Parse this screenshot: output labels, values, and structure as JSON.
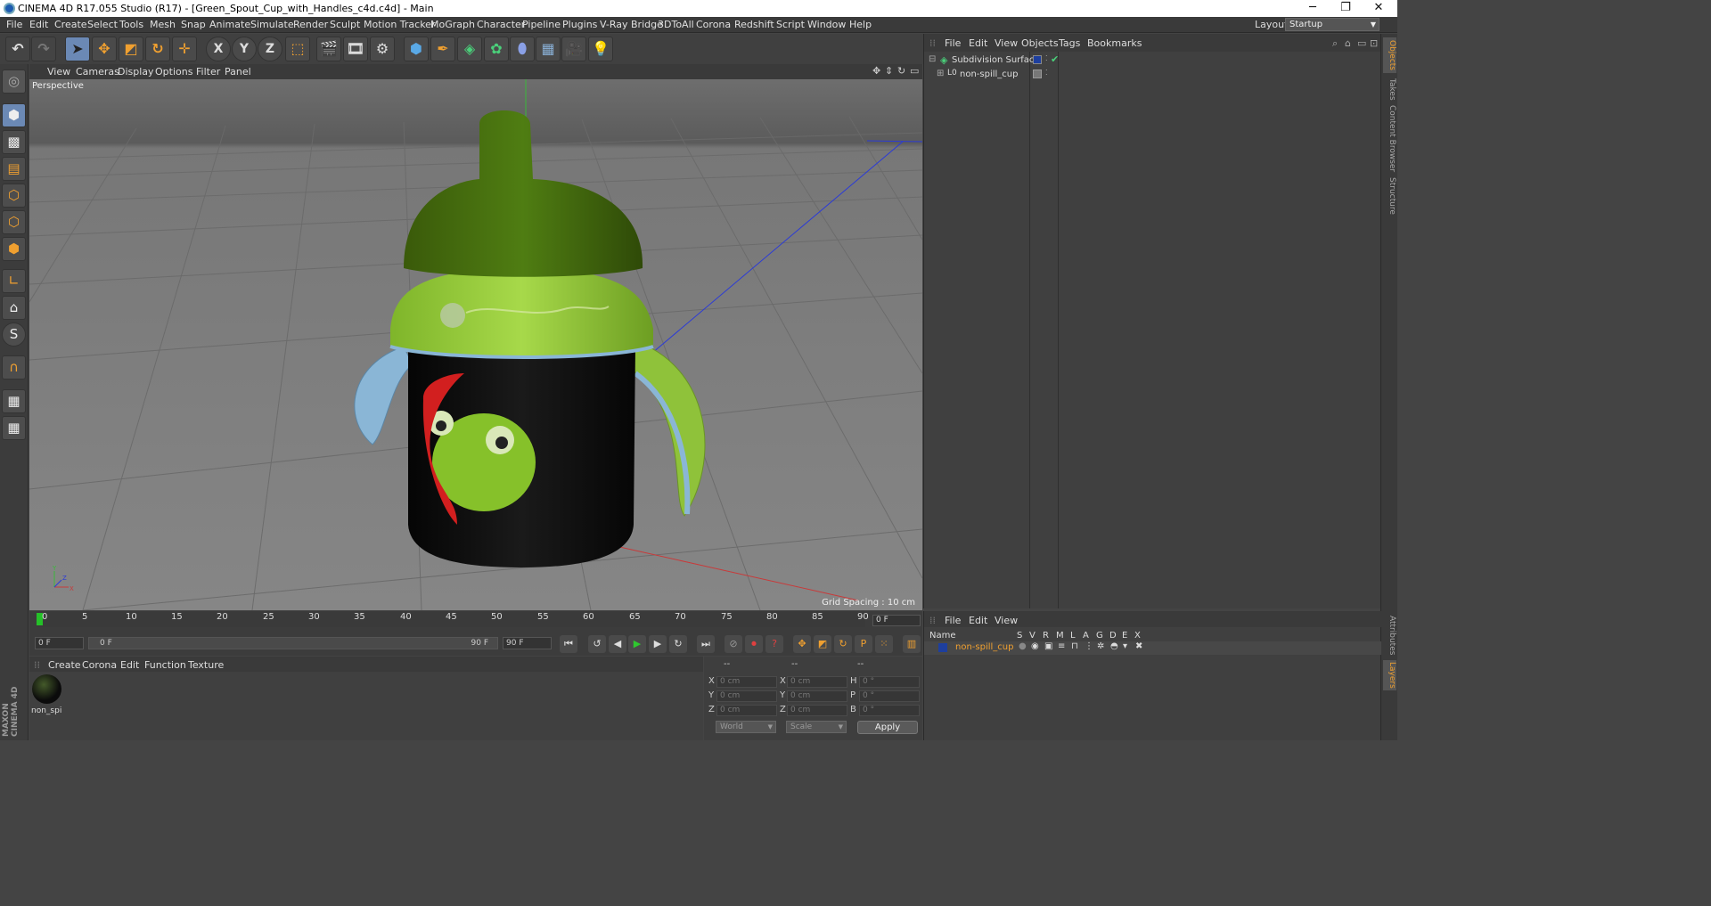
{
  "window": {
    "title": "CINEMA 4D R17.055 Studio (R17) - [Green_Spout_Cup_with_Handles_c4d.c4d] - Main",
    "minimize": "─",
    "restore": "❐",
    "close": "✕"
  },
  "menubar": {
    "items": [
      "File",
      "Edit",
      "Create",
      "Select",
      "Tools",
      "Mesh",
      "Snap",
      "Animate",
      "Simulate",
      "Render",
      "Sculpt",
      "Motion Tracker",
      "MoGraph",
      "Character",
      "Pipeline",
      "Plugins",
      "V-Ray Bridge",
      "3DToAll",
      "Corona",
      "Redshift",
      "Script",
      "Window",
      "Help"
    ],
    "layout_label": "Layout:",
    "layout_value": "Startup"
  },
  "toolbar": {
    "axis_x": "X",
    "axis_y": "Y",
    "axis_z": "Z"
  },
  "viewport": {
    "menu": [
      "View",
      "Cameras",
      "Display",
      "Options",
      "Filter",
      "Panel"
    ],
    "label": "Perspective",
    "grid_spacing": "Grid Spacing : 10 cm"
  },
  "object_manager": {
    "menu": [
      "File",
      "Edit",
      "View",
      "Objects",
      "Tags",
      "Bookmarks"
    ],
    "objects": [
      {
        "name": "Subdivision Surface",
        "color": "#1e3f9e"
      },
      {
        "name": "non-spill_cup",
        "color": "#888888"
      }
    ]
  },
  "right_tabs": [
    "Objects",
    "Takes",
    "Content Browser",
    "Structure",
    "Attributes",
    "Layers"
  ],
  "timeline": {
    "ticks": [
      "0",
      "5",
      "10",
      "15",
      "20",
      "25",
      "30",
      "35",
      "40",
      "45",
      "50",
      "55",
      "60",
      "65",
      "70",
      "75",
      "80",
      "85",
      "90"
    ],
    "current_frame": "0 F",
    "start_field": "0 F",
    "range_start": "0 F",
    "range_end": "90 F",
    "end_field": "90 F"
  },
  "material_manager": {
    "menu": [
      "Create",
      "Corona",
      "Edit",
      "Function",
      "Texture"
    ],
    "material_name": "non_spi"
  },
  "coordinates": {
    "header": [
      "--",
      "--",
      "--"
    ],
    "rows": [
      {
        "l1": "X",
        "v1": "0 cm",
        "l2": "X",
        "v2": "0 cm",
        "l3": "H",
        "v3": "0 °"
      },
      {
        "l1": "Y",
        "v1": "0 cm",
        "l2": "Y",
        "v2": "0 cm",
        "l3": "P",
        "v3": "0 °"
      },
      {
        "l1": "Z",
        "v1": "0 cm",
        "l2": "Z",
        "v2": "0 cm",
        "l3": "B",
        "v3": "0 °"
      }
    ],
    "space": "World",
    "mode": "Scale",
    "apply": "Apply"
  },
  "layer_manager": {
    "menu": [
      "File",
      "Edit",
      "View"
    ],
    "columns": [
      "Name",
      "S",
      "V",
      "R",
      "M",
      "L",
      "A",
      "G",
      "D",
      "E",
      "X"
    ],
    "layer_name": "non-spill_cup",
    "layer_color": "#1e3f9e"
  },
  "branding": "MAXON CINEMA 4D"
}
